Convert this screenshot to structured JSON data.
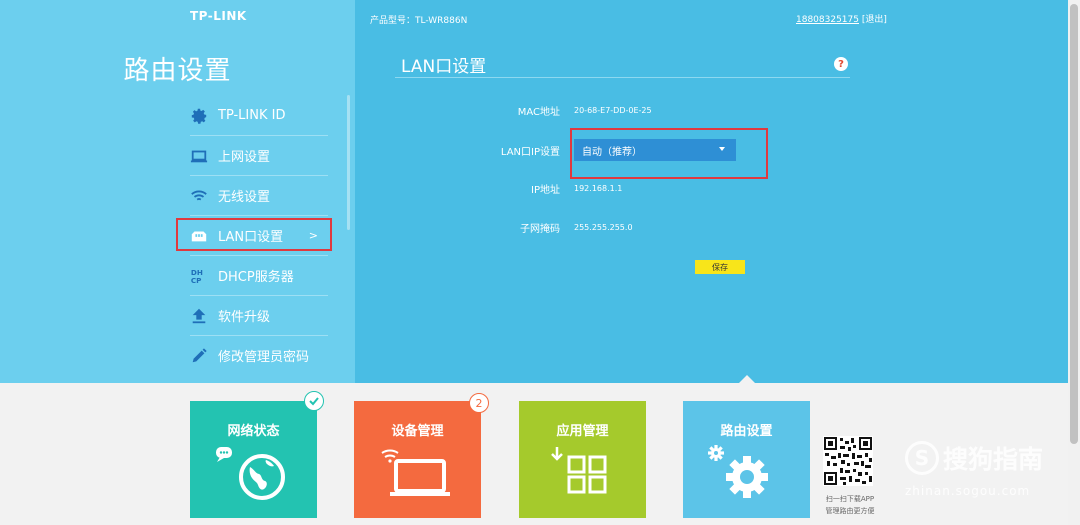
{
  "brand": {
    "logo_text": "TP-LINK"
  },
  "sidebar": {
    "title": "路由设置",
    "items": [
      {
        "label": "TP-LINK ID",
        "icon": "gear-icon"
      },
      {
        "label": "上网设置",
        "icon": "laptop-icon"
      },
      {
        "label": "无线设置",
        "icon": "wifi-icon"
      },
      {
        "label": "LAN口设置",
        "icon": "lan-port-icon",
        "arrow": ">"
      },
      {
        "label": "DHCP服务器",
        "icon": "dhcp-icon"
      },
      {
        "label": "软件升级",
        "icon": "upload-icon"
      },
      {
        "label": "修改管理员密码",
        "icon": "pencil-icon"
      }
    ]
  },
  "header": {
    "model_label": "产品型号：TL-WR886N",
    "account": "18808325175",
    "logout": "[退出]"
  },
  "main": {
    "section_title": "LAN口设置",
    "help": "?",
    "fields": {
      "mac_label": "MAC地址",
      "mac_value": "20-68-E7-DD-0E-25",
      "lan_ip_label": "LAN口IP设置",
      "lan_ip_value": "自动（推荐）",
      "ip_label": "IP地址",
      "ip_value": "192.168.1.1",
      "mask_label": "子网掩码",
      "mask_value": "255.255.255.0"
    },
    "save_label": "保存"
  },
  "bottom_tiles": [
    {
      "label": "网络状态",
      "icon": "globe-icon",
      "color": "#23c3b1"
    },
    {
      "label": "设备管理",
      "icon": "laptop-wifi-icon",
      "color": "#f46a3f",
      "badge": "2"
    },
    {
      "label": "应用管理",
      "icon": "apps-grid-icon",
      "color": "#a5ca2c"
    },
    {
      "label": "路由设置",
      "icon": "gear-icon",
      "color": "#5cc4e8"
    }
  ],
  "qr": {
    "line1": "扫一扫下载APP",
    "line2": "管理路由更方便"
  },
  "watermark": {
    "main": "搜狗指南",
    "sub": "zhinan.sogou.com"
  },
  "colors": {
    "left_panel": "#6ccfee",
    "right_panel": "#49bde4",
    "select_bg": "#2e8fd5",
    "save_btn": "#f8e51a",
    "highlight_border": "#e0393e"
  }
}
